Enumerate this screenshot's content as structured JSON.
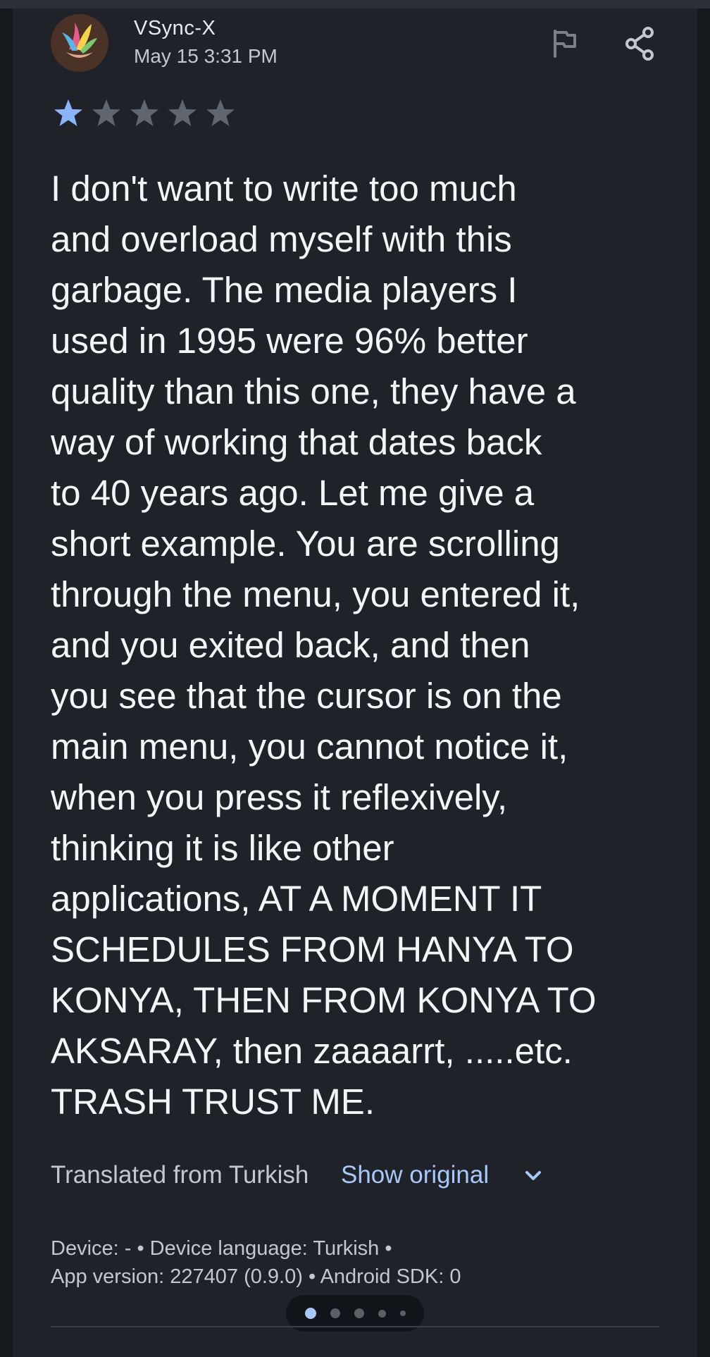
{
  "review": {
    "reviewer_name": "VSync-X",
    "date": "May 15 3:31 PM",
    "rating": 1,
    "max_rating": 5,
    "text": "I don't want to write too much\nand overload myself with this\ngarbage. The media players I\nused in 1995 were 96% better\nquality than this one, they have a\nway of working that dates back\nto 40 years ago. Let me give a\nshort example. You are scrolling\nthrough the menu, you entered it,\nand you exited back, and then\nyou see that the cursor is on the\nmain menu, you cannot notice it,\nwhen you press it reflexively,\nthinking it is like other\napplications, AT A MOMENT IT\nSCHEDULES FROM HANYA TO\nKONYA, THEN FROM KONYA TO\nAKSARAY, then zaaaarrt, .....etc.\nTRASH TRUST ME.",
    "translated_label": "Translated from Turkish",
    "show_original_label": "Show original",
    "meta_line1": "Device: - • Device language: Turkish •",
    "meta_line2": "App version: 227407 (0.9.0) • Android SDK: 0"
  },
  "icons": {
    "avatar": "app-logo-avatar",
    "flag": "flag-icon",
    "share": "share-icon",
    "expand": "chevron-down-icon"
  },
  "colors": {
    "background": "#1f2329",
    "star_filled": "#8ab4f8",
    "star_empty": "#5f6670",
    "accent": "#a8c7fa"
  },
  "pager": {
    "page_count": 5,
    "active_index": 0
  }
}
